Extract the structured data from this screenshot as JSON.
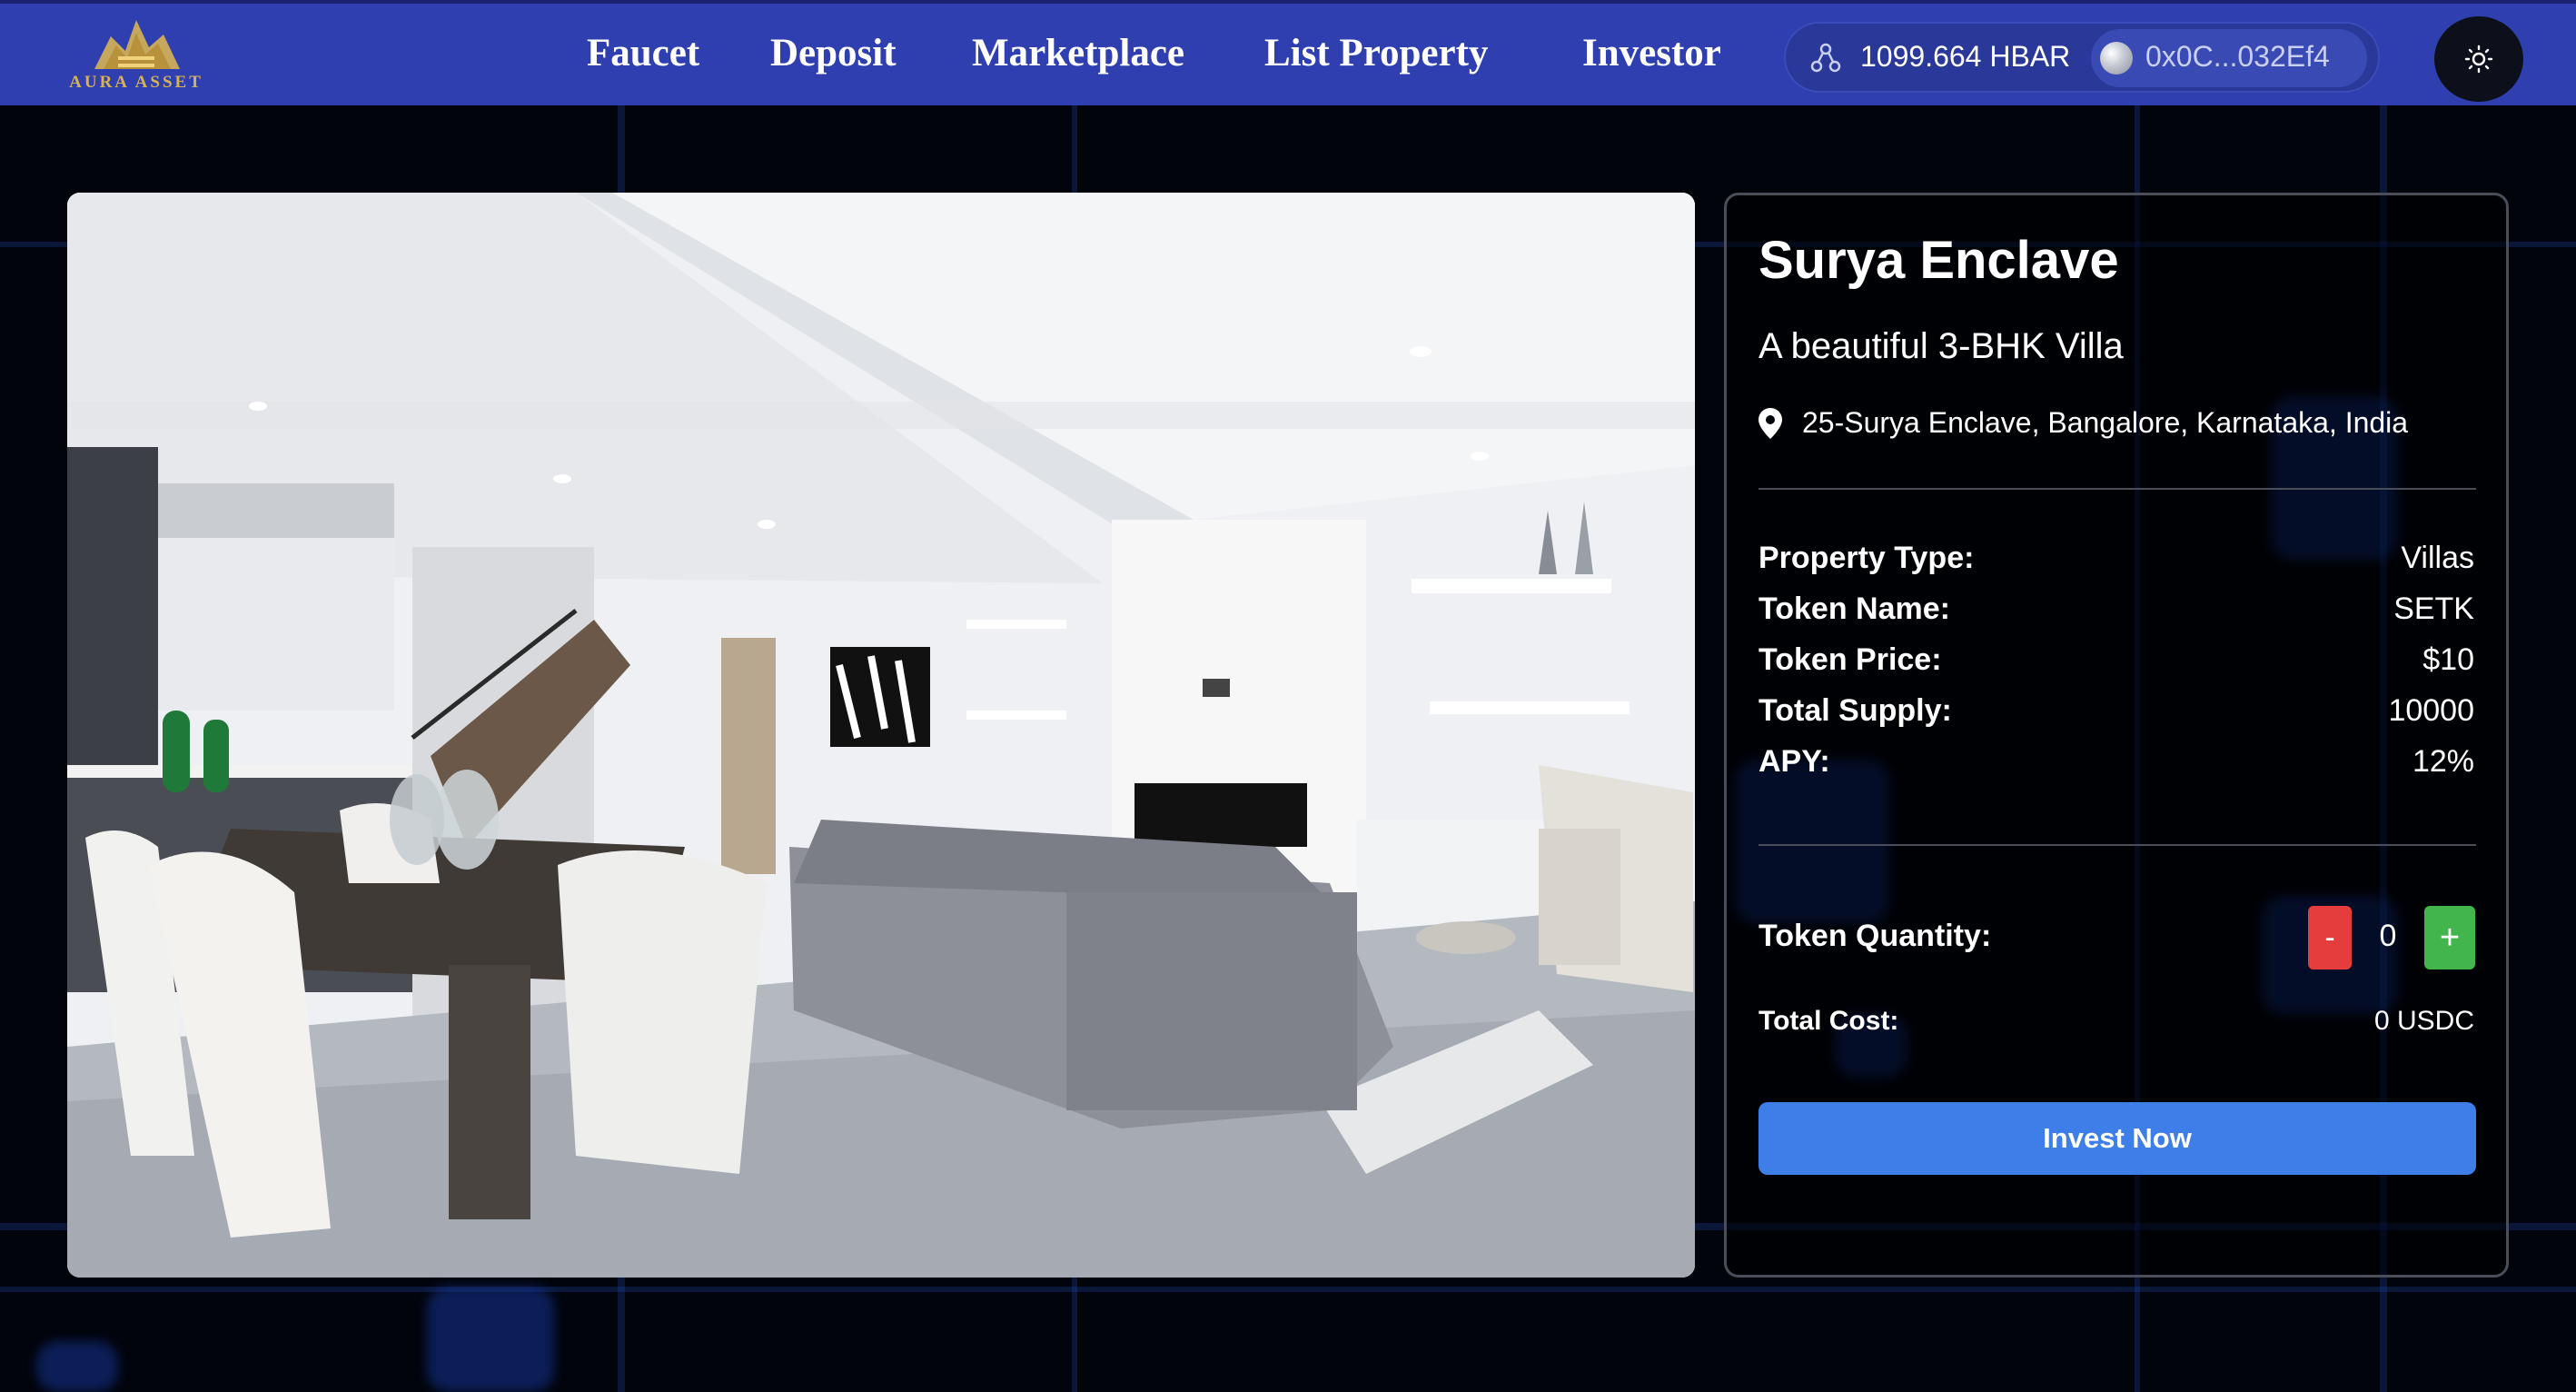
{
  "brand": {
    "name": "AURA ASSET",
    "gold": "#d6b254"
  },
  "nav": {
    "links": [
      {
        "label": "Faucet"
      },
      {
        "label": "Deposit"
      },
      {
        "label": "Marketplace"
      },
      {
        "label": "List Property"
      },
      {
        "label": "Investor"
      }
    ],
    "wallet": {
      "balance": "1099.664 HBAR",
      "address": "0x0C...032Ef4",
      "hbar_icon": "hbar-logo-icon",
      "avatar": "wallet-avatar"
    },
    "theme_icon": "sun-icon",
    "background_color": "#2f3fb0"
  },
  "property": {
    "title": "Surya Enclave",
    "subtitle": "A beautiful 3-BHK Villa",
    "location": "25-Surya Enclave, Bangalore, Karnataka, India",
    "location_icon": "map-pin-icon",
    "image_alt": "living-dining-room-photo",
    "details": [
      {
        "label": "Property Type:",
        "value": "Villas"
      },
      {
        "label": "Token Name:",
        "value": "SETK"
      },
      {
        "label": "Token Price:",
        "value": "$10"
      },
      {
        "label": "Total Supply:",
        "value": "10000"
      },
      {
        "label": "APY:",
        "value": "12%"
      }
    ]
  },
  "purchase": {
    "quantity_label": "Token Quantity:",
    "minus_label": "-",
    "quantity": "0",
    "plus_label": "+",
    "cost_label": "Total Cost:",
    "cost_value": "0 USDC",
    "invest_label": "Invest Now",
    "invest_color": "#3d7ee8",
    "minus_color": "#e53d3d",
    "plus_color": "#43b54d"
  }
}
